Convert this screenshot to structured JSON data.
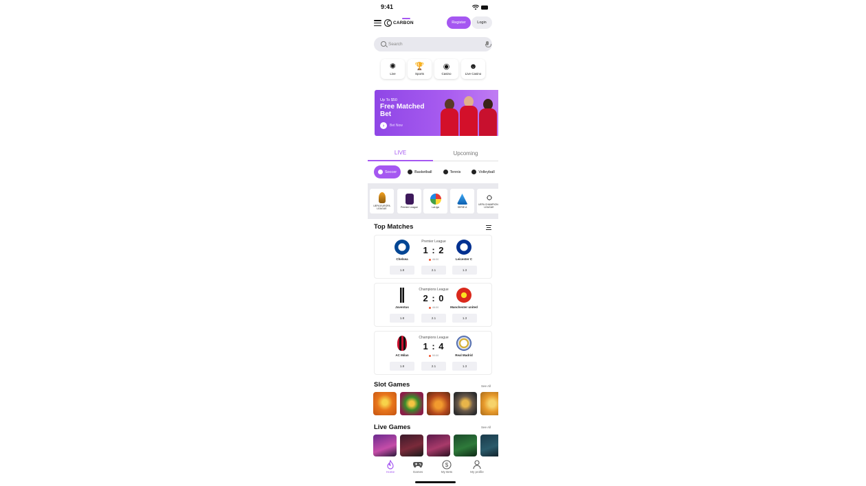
{
  "status_bar": {
    "time": "9:41"
  },
  "header": {
    "logo_text": "CARBON",
    "register_label": "Register",
    "login_label": "Login"
  },
  "search": {
    "placeholder": "Search"
  },
  "categories": [
    {
      "label": "Live",
      "icon": "live-icon"
    },
    {
      "label": "Sports",
      "icon": "trophy-icon"
    },
    {
      "label": "Casino",
      "icon": "casino-chip-icon"
    },
    {
      "label": "Live Casino",
      "icon": "dealer-icon"
    }
  ],
  "promo": {
    "small_text": "Up To $50",
    "big_text": "Free Matched Bet",
    "cta_label": "Bet Now"
  },
  "tabs": {
    "live": "LIVE",
    "upcoming": "Upcoming"
  },
  "sports": [
    "Soccer",
    "Basketball",
    "Tennis",
    "Volleyball"
  ],
  "leagues": [
    {
      "name": "UEFA EUROPA LEAGUE"
    },
    {
      "name": "Premier League"
    },
    {
      "name": "LaLiga"
    },
    {
      "name": "SERIE A"
    },
    {
      "name": "UEFA CHAMPIONS LEAGUE"
    }
  ],
  "top_matches": {
    "title": "Top Matches",
    "matches": [
      {
        "competition": "Premier League",
        "home": "Chelsea",
        "away": "Leicester C",
        "score": "1 : 2",
        "clock": "46:00",
        "odds": [
          "1.8",
          "2.1",
          "1.3"
        ]
      },
      {
        "competition": "Champions League",
        "home": "Juventus",
        "away": "Manchester united",
        "score": "2 : 0",
        "clock": "46:00",
        "odds": [
          "1.8",
          "2.1",
          "1.3"
        ]
      },
      {
        "competition": "Champions League",
        "home": "AC Milan",
        "away": "Real Madrid",
        "score": "1 : 4",
        "clock": "90:00",
        "odds": [
          "1.8",
          "2.1",
          "1.3"
        ]
      }
    ]
  },
  "slot_games": {
    "title": "Slot Games",
    "see_all": "See All"
  },
  "live_games": {
    "title": "Live Games",
    "see_all": "See All"
  },
  "tab_bar": [
    {
      "label": "Home",
      "icon": "flame-icon",
      "active": true
    },
    {
      "label": "Games",
      "icon": "gamepad-icon",
      "active": false
    },
    {
      "label": "My Bets",
      "icon": "dollar-icon",
      "active": false
    },
    {
      "label": "My profile",
      "icon": "profile-icon",
      "active": false
    }
  ],
  "colors": {
    "accent": "#a557f1",
    "live_dot": "#f2522e"
  }
}
